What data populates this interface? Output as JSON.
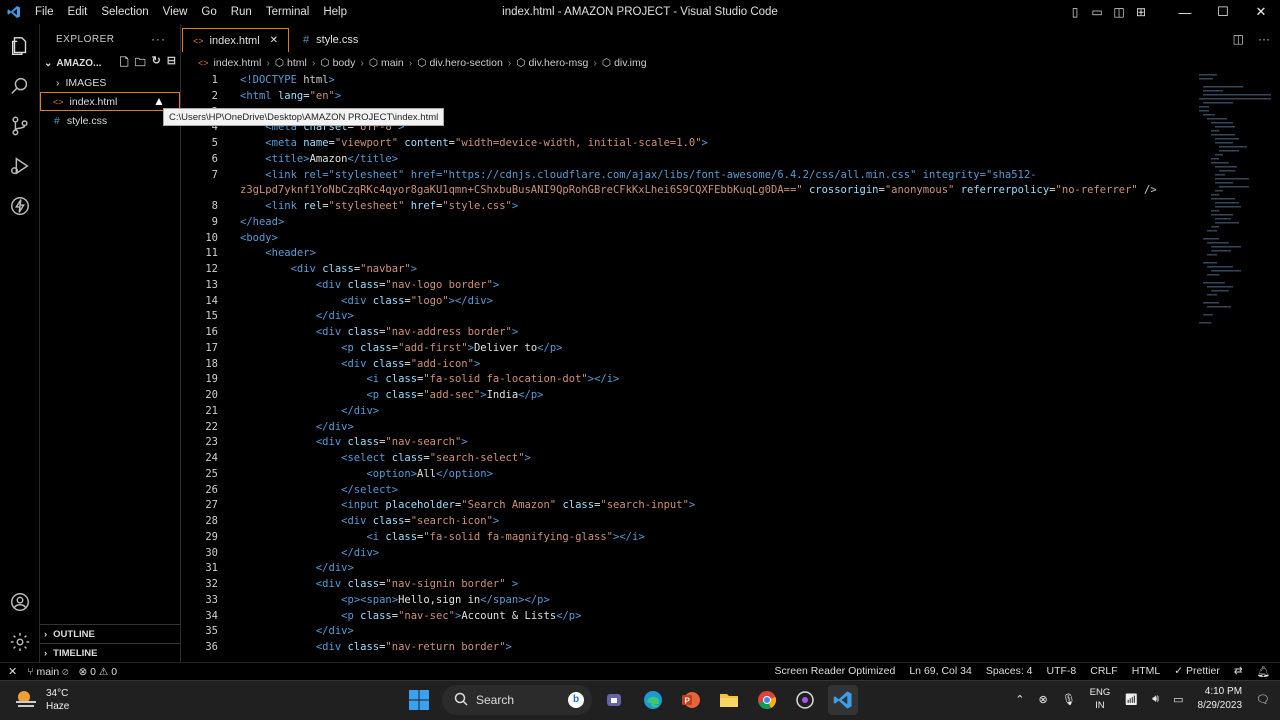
{
  "window": {
    "title": "index.html - AMAZON PROJECT - Visual Studio Code",
    "menu": [
      "File",
      "Edit",
      "Selection",
      "View",
      "Go",
      "Run",
      "Terminal",
      "Help"
    ]
  },
  "sidebar": {
    "header": "EXPLORER",
    "project": "AMAZO...",
    "items": [
      {
        "label": "IMAGES",
        "type": "folder"
      },
      {
        "label": "index.html",
        "type": "html"
      },
      {
        "label": "style.css",
        "type": "css"
      }
    ],
    "outline": "OUTLINE",
    "timeline": "TIMELINE"
  },
  "tooltip": "C:\\Users\\HP\\OneDrive\\Desktop\\AMAZON PROJECT\\index.html",
  "tabs": [
    {
      "label": "index.html",
      "close": "✕"
    },
    {
      "label": "style.css"
    }
  ],
  "breadcrumb": [
    "index.html",
    "html",
    "body",
    "main",
    "div.hero-section",
    "div.hero-msg",
    "div.img"
  ],
  "editor": {
    "lines": [
      {
        "n": "1",
        "code": "<!DOCTYPE html>"
      },
      {
        "n": "2",
        "code": "<html lang=\"en\">"
      },
      {
        "n": "3",
        "code": ""
      },
      {
        "n": "4",
        "code": "    <meta charset=\"UTF-8\">"
      },
      {
        "n": "5",
        "code": "    <meta name=\"viewport\" content=\"width=device-width, initial-scale=1.0\">"
      },
      {
        "n": "6",
        "code": "    <title>Amazon</title>"
      },
      {
        "n": "7",
        "code": "    <link rel=\"stylesheet\" href=\"https://cdnjs.cloudflare.com/ajax/libs/font-awesome/6.4.2/css/all.min.css\" integrity=\"sha512-"
      },
      {
        "n": "",
        "code": "z3gLpd7yknf1YoNbCzqRKc4qyor8gaKU1qmn+CShxbuBusANI9QpRohGBreCFkKxLhei6S9CQXFEbbKuqLg0DA==\" crossorigin=\"anonymous\" referrerpolicy=\"no-referrer\" />"
      },
      {
        "n": "8",
        "code": "    <link rel=\"stylesheet\" href=\"style.css\">"
      },
      {
        "n": "9",
        "code": "</head>"
      },
      {
        "n": "10",
        "code": "<body>"
      },
      {
        "n": "11",
        "code": "    <header>"
      },
      {
        "n": "12",
        "code": "        <div class=\"navbar\">"
      },
      {
        "n": "13",
        "code": "            <div class=\"nav-logo border\">"
      },
      {
        "n": "14",
        "code": "                <div class=\"logo\"></div>"
      },
      {
        "n": "15",
        "code": "            </div>"
      },
      {
        "n": "16",
        "code": "            <div class=\"nav-address border\">"
      },
      {
        "n": "17",
        "code": "                <p class=\"add-first\">Deliver to</p>"
      },
      {
        "n": "18",
        "code": "                <div class=\"add-icon\">"
      },
      {
        "n": "19",
        "code": "                    <i class=\"fa-solid fa-location-dot\"></i>"
      },
      {
        "n": "20",
        "code": "                    <p class=\"add-sec\">India</p>"
      },
      {
        "n": "21",
        "code": "                </div>"
      },
      {
        "n": "22",
        "code": "            </div>"
      },
      {
        "n": "23",
        "code": "            <div class=\"nav-search\">"
      },
      {
        "n": "24",
        "code": "                <select class=\"search-select\">"
      },
      {
        "n": "25",
        "code": "                    <option>All</option>"
      },
      {
        "n": "26",
        "code": "                </select>"
      },
      {
        "n": "27",
        "code": "                <input placeholder=\"Search Amazon\" class=\"search-input\">"
      },
      {
        "n": "28",
        "code": "                <div class=\"search-icon\">"
      },
      {
        "n": "29",
        "code": "                    <i class=\"fa-solid fa-magnifying-glass\"></i>"
      },
      {
        "n": "30",
        "code": "                </div>"
      },
      {
        "n": "31",
        "code": "            </div>"
      },
      {
        "n": "32",
        "code": "            <div class=\"nav-signin border\" >"
      },
      {
        "n": "33",
        "code": "                <p><span>Hello,sign in</span></p>"
      },
      {
        "n": "34",
        "code": "                <p class=\"nav-sec\">Account & Lists</p>"
      },
      {
        "n": "35",
        "code": "            </div>"
      },
      {
        "n": "36",
        "code": "            <div class=\"nav-return border\">"
      }
    ]
  },
  "status": {
    "branch": "main",
    "problems": "⊗ 0 ⚠ 0",
    "screen_reader": "Screen Reader Optimized",
    "position": "Ln 69, Col 34",
    "spaces": "Spaces: 4",
    "encoding": "UTF-8",
    "eol": "CRLF",
    "language": "HTML",
    "formatter": "✓ Prettier"
  },
  "taskbar": {
    "temp": "34°C",
    "weather": "Haze",
    "search": "Search",
    "lang1": "ENG",
    "lang2": "IN",
    "time": "4:10 PM",
    "date": "8/29/2023"
  },
  "colors": {
    "accent": "#e07b2a",
    "tag": "#569cd6",
    "attr": "#9cdcfe",
    "string": "#ce9178"
  }
}
